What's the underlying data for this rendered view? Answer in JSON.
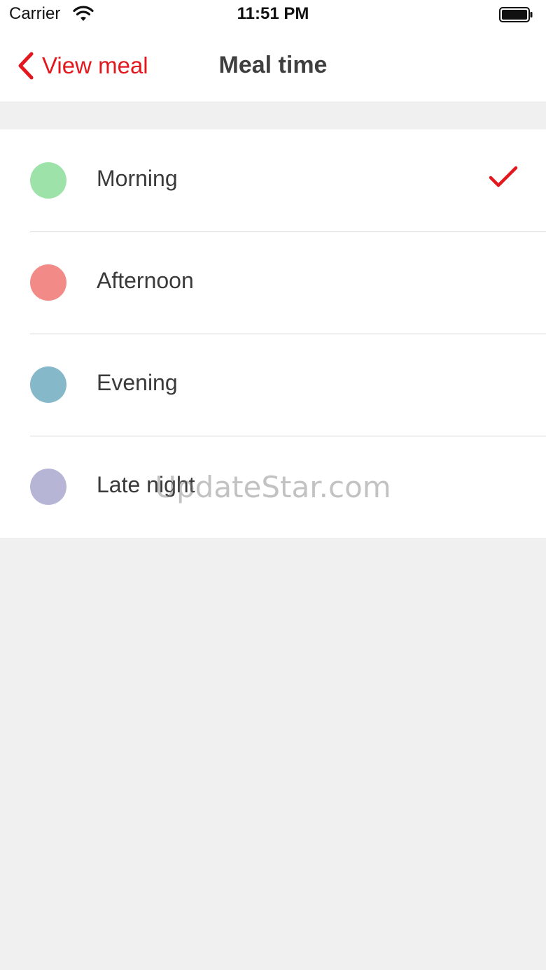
{
  "status_bar": {
    "carrier": "Carrier",
    "time": "11:51 PM",
    "wifi_icon": "wifi-icon",
    "battery_icon": "battery-icon"
  },
  "nav": {
    "back_label": "View meal",
    "back_icon": "chevron-left-icon",
    "title": "Meal time",
    "accent_color": "#e3181f"
  },
  "meal_times": [
    {
      "label": "Morning",
      "color": "#9de3a9",
      "selected": true
    },
    {
      "label": "Afternoon",
      "color": "#f28b87",
      "selected": false
    },
    {
      "label": "Evening",
      "color": "#85b9c9",
      "selected": false
    },
    {
      "label": "Late night",
      "color": "#b6b5d6",
      "selected": false
    }
  ],
  "selected_icon": "checkmark-icon",
  "watermark": "UpdateStar.com"
}
